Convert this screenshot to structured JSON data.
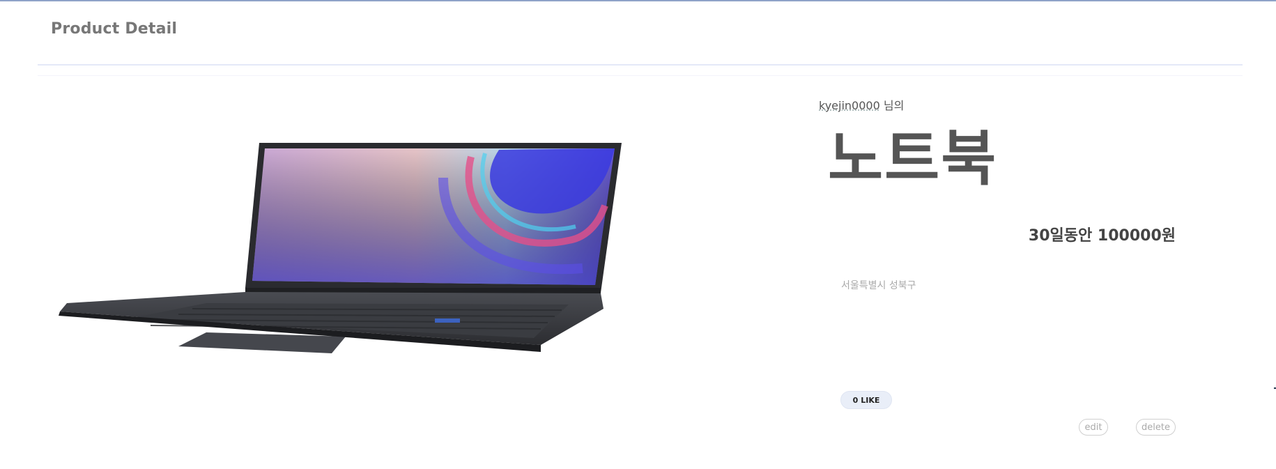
{
  "header": {
    "title": "Product Detail"
  },
  "product": {
    "owner_name": "kyejin0000",
    "owner_suffix": "님의",
    "name": "노트북",
    "price": "30일동안 100000원",
    "location": "서울특별시 성북구",
    "image_alt": "노트북"
  },
  "actions": {
    "like_count": "0",
    "like_label": "LIKE",
    "edit_label": "edit",
    "delete_label": "delete"
  },
  "colors": {
    "top_bar": "#8fa3c8",
    "divider": "#e4e8f8",
    "like_bg": "#e9eef8",
    "title_text": "#777777"
  }
}
